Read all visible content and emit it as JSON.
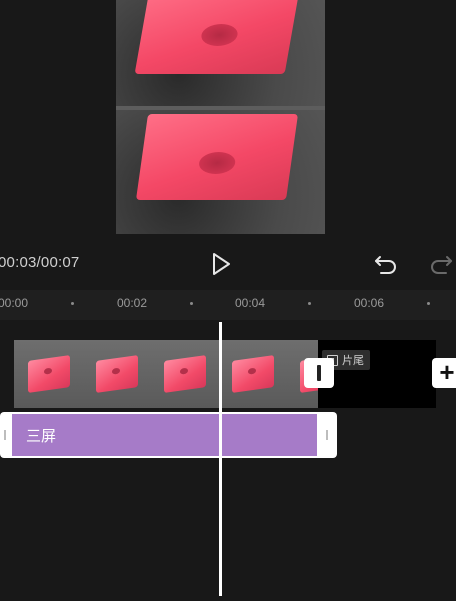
{
  "player": {
    "time_display": "00:03/00:07"
  },
  "toolbar": {
    "play_icon": "play-icon",
    "undo_icon": "undo-icon",
    "redo_icon": "redo-icon"
  },
  "timeline": {
    "ruler_labels": [
      "00:00",
      "00:02",
      "00:04",
      "00:06"
    ],
    "ending_label": "片尾",
    "text_clip_label": "三屏",
    "add_label": "+"
  },
  "colors": {
    "background": "#181818",
    "text_clip": "#a67bc8",
    "cube": "#f44866"
  }
}
